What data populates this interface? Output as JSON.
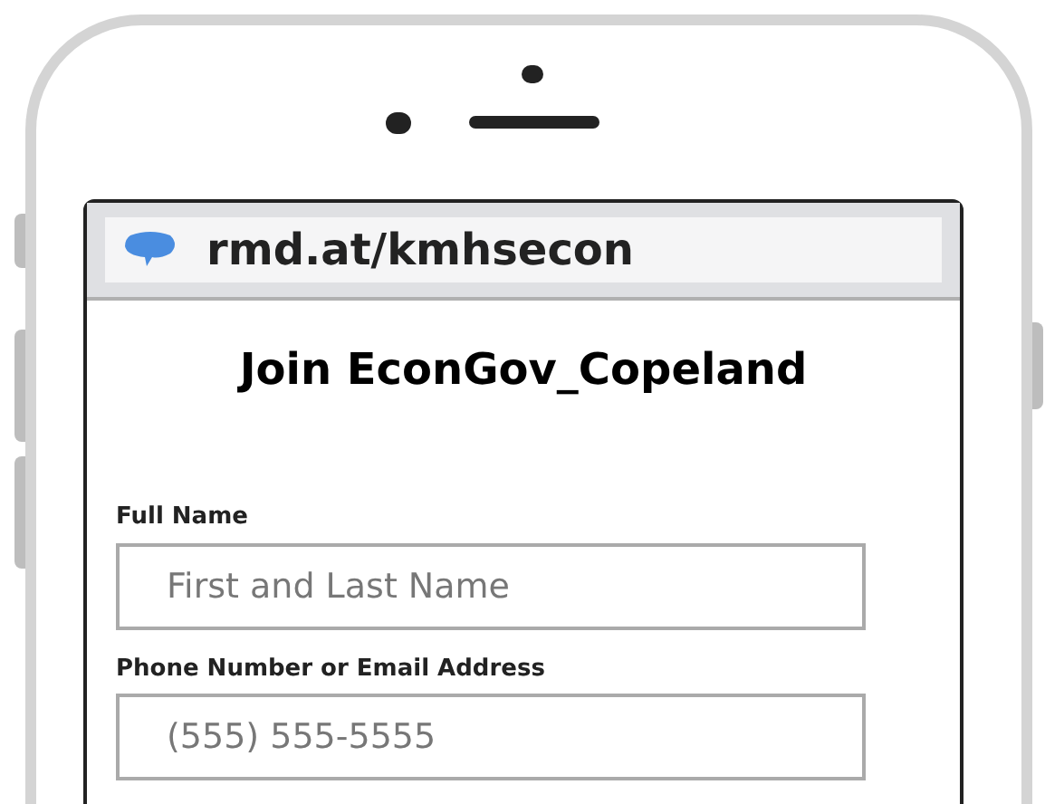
{
  "browser": {
    "url": "rmd.at/kmhsecon"
  },
  "page": {
    "title": "Join EconGov_Copeland",
    "fields": [
      {
        "label": "Full Name",
        "placeholder": "First and Last Name"
      },
      {
        "label": "Phone Number or Email Address",
        "placeholder": "(555) 555-5555"
      }
    ]
  }
}
